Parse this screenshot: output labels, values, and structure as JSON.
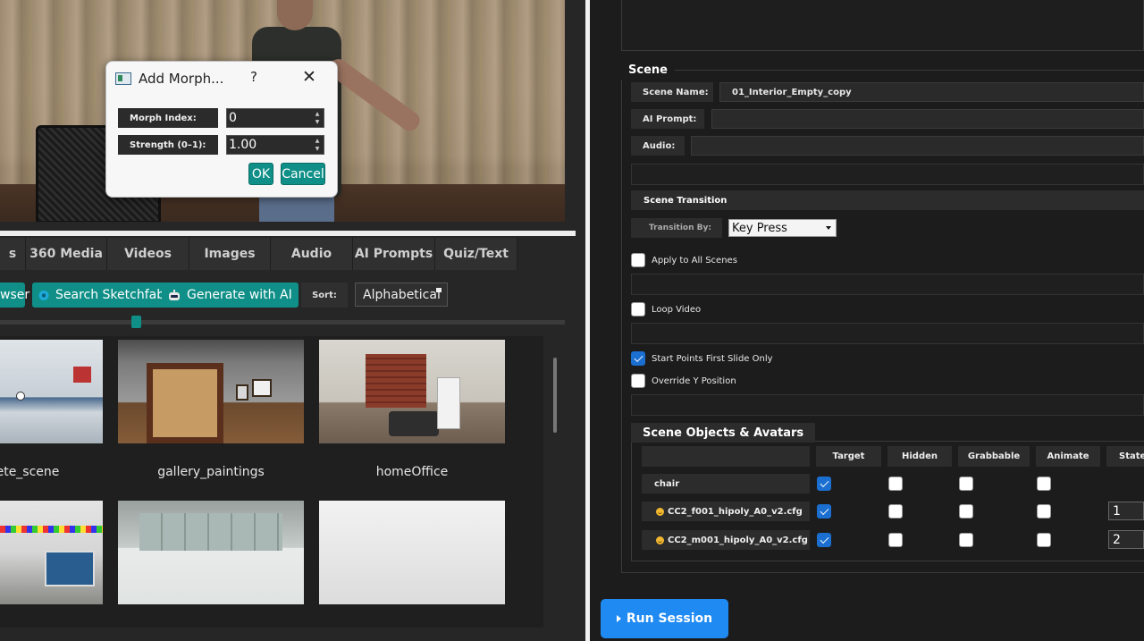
{
  "dialog": {
    "title": "Add Morph...",
    "help": "?",
    "close": "✕",
    "morph_index_label": "Morph Index:",
    "morph_index_value": "0",
    "strength_label": "Strength (0–1):",
    "strength_value": "1.00",
    "ok": "OK",
    "cancel": "Cancel"
  },
  "tabs": [
    {
      "label": "s"
    },
    {
      "label": "360 Media"
    },
    {
      "label": "Videos"
    },
    {
      "label": "Images"
    },
    {
      "label": "Audio"
    },
    {
      "label": "AI Prompts"
    },
    {
      "label": "Quiz/Text"
    }
  ],
  "toolbar": {
    "browser_label": "wser",
    "sketchfab_label": "Search Sketchfab",
    "generate_label": "Generate with AI",
    "sort_label": "Sort:",
    "sort_value": "Alphabetical"
  },
  "gallery": {
    "items": [
      {
        "label": "ete_scene"
      },
      {
        "label": "gallery_paintings"
      },
      {
        "label": "homeOffice"
      },
      {
        "label": ""
      },
      {
        "label": ""
      },
      {
        "label": ""
      }
    ]
  },
  "scene": {
    "title": "Scene",
    "name_label": "Scene Name:",
    "name_value": "01_Interior_Empty_copy",
    "ai_prompt_label": "AI Prompt:",
    "ai_prompt_value": "",
    "audio_label": "Audio:",
    "audio_value": "",
    "transition_title": "Scene Transition",
    "transition_by_label": "Transition By:",
    "transition_by_value": "Key Press",
    "apply_all_label": "Apply to All Scenes",
    "loop_video_label": "Loop Video",
    "start_points_label": "Start Points First Slide Only",
    "override_y_label": "Override Y Position"
  },
  "objects": {
    "title": "Scene Objects & Avatars",
    "columns": [
      "Target",
      "Hidden",
      "Grabbable",
      "Animate",
      "State"
    ],
    "rows": [
      {
        "name": "chair",
        "avatar": false,
        "target": true,
        "hidden": false,
        "grabbable": false,
        "animate": false,
        "state": ""
      },
      {
        "name": "CC2_f001_hipoly_A0_v2.cfg",
        "avatar": true,
        "target": true,
        "hidden": false,
        "grabbable": false,
        "animate": false,
        "state": "1"
      },
      {
        "name": "CC2_m001_hipoly_A0_v2.cfg",
        "avatar": true,
        "target": true,
        "hidden": false,
        "grabbable": false,
        "animate": false,
        "state": "2"
      }
    ]
  },
  "run_button": "Run Session",
  "colors": {
    "accent_teal": "#0f8f87",
    "run_blue": "#1f8af2",
    "checkbox_blue": "#1a6fd0"
  }
}
